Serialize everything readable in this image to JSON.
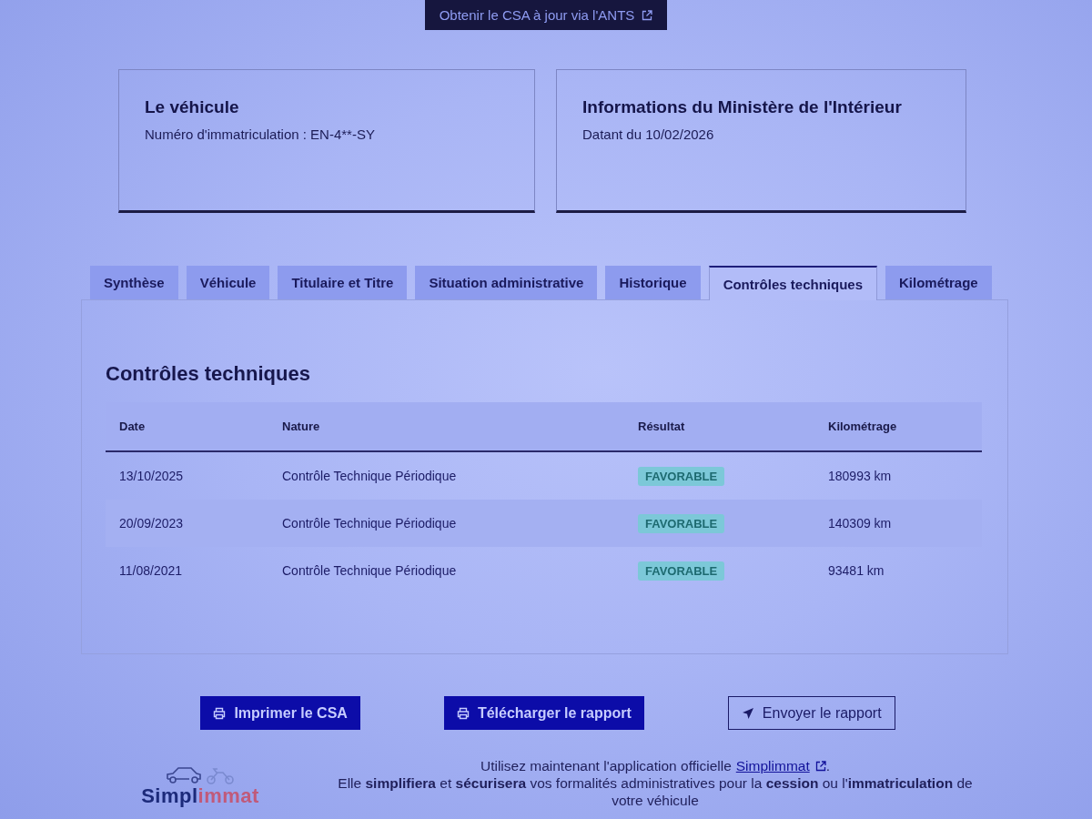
{
  "top_button": {
    "label": "Obtenir le CSA à jour via l'ANTS"
  },
  "cards": [
    {
      "title": "Le véhicule",
      "text": "Numéro d'immatriculation : EN-4**-SY"
    },
    {
      "title": "Informations du Ministère de l'Intérieur",
      "text": "Datant du 10/02/2026"
    }
  ],
  "tabs": [
    {
      "label": "Synthèse",
      "selected": false
    },
    {
      "label": "Véhicule",
      "selected": false
    },
    {
      "label": "Titulaire et Titre",
      "selected": false
    },
    {
      "label": "Situation administrative",
      "selected": false
    },
    {
      "label": "Historique",
      "selected": false
    },
    {
      "label": "Contrôles techniques",
      "selected": true
    },
    {
      "label": "Kilométrage",
      "selected": false
    }
  ],
  "panel": {
    "title": "Contrôles techniques",
    "table": {
      "columns": [
        "Date",
        "Nature",
        "Résultat",
        "Kilométrage"
      ],
      "rows": [
        {
          "date": "13/10/2025",
          "nature": "Contrôle Technique Périodique",
          "result": "FAVORABLE",
          "mileage": "180993 km"
        },
        {
          "date": "20/09/2023",
          "nature": "Contrôle Technique Périodique",
          "result": "FAVORABLE",
          "mileage": "140309 km"
        },
        {
          "date": "11/08/2021",
          "nature": "Contrôle Technique Périodique",
          "result": "FAVORABLE",
          "mileage": "93481 km"
        }
      ]
    }
  },
  "buttons": [
    {
      "label": "Imprimer le CSA",
      "kind": "primary"
    },
    {
      "label": "Télécharger le rapport",
      "kind": "primary"
    },
    {
      "label": "Envoyer le rapport",
      "kind": "secondary"
    }
  ],
  "footer": {
    "logo": [
      "Simpl",
      "immat"
    ],
    "line_1": {
      "before": "Utilisez maintenant l'application officielle",
      "link": "Simplimmat",
      "after": "."
    },
    "line_2": "Elle **simplifiera** et **sécurisera** vos formalités administratives pour la **cession** ou l'**immatriculation** de votre véhicule"
  }
}
